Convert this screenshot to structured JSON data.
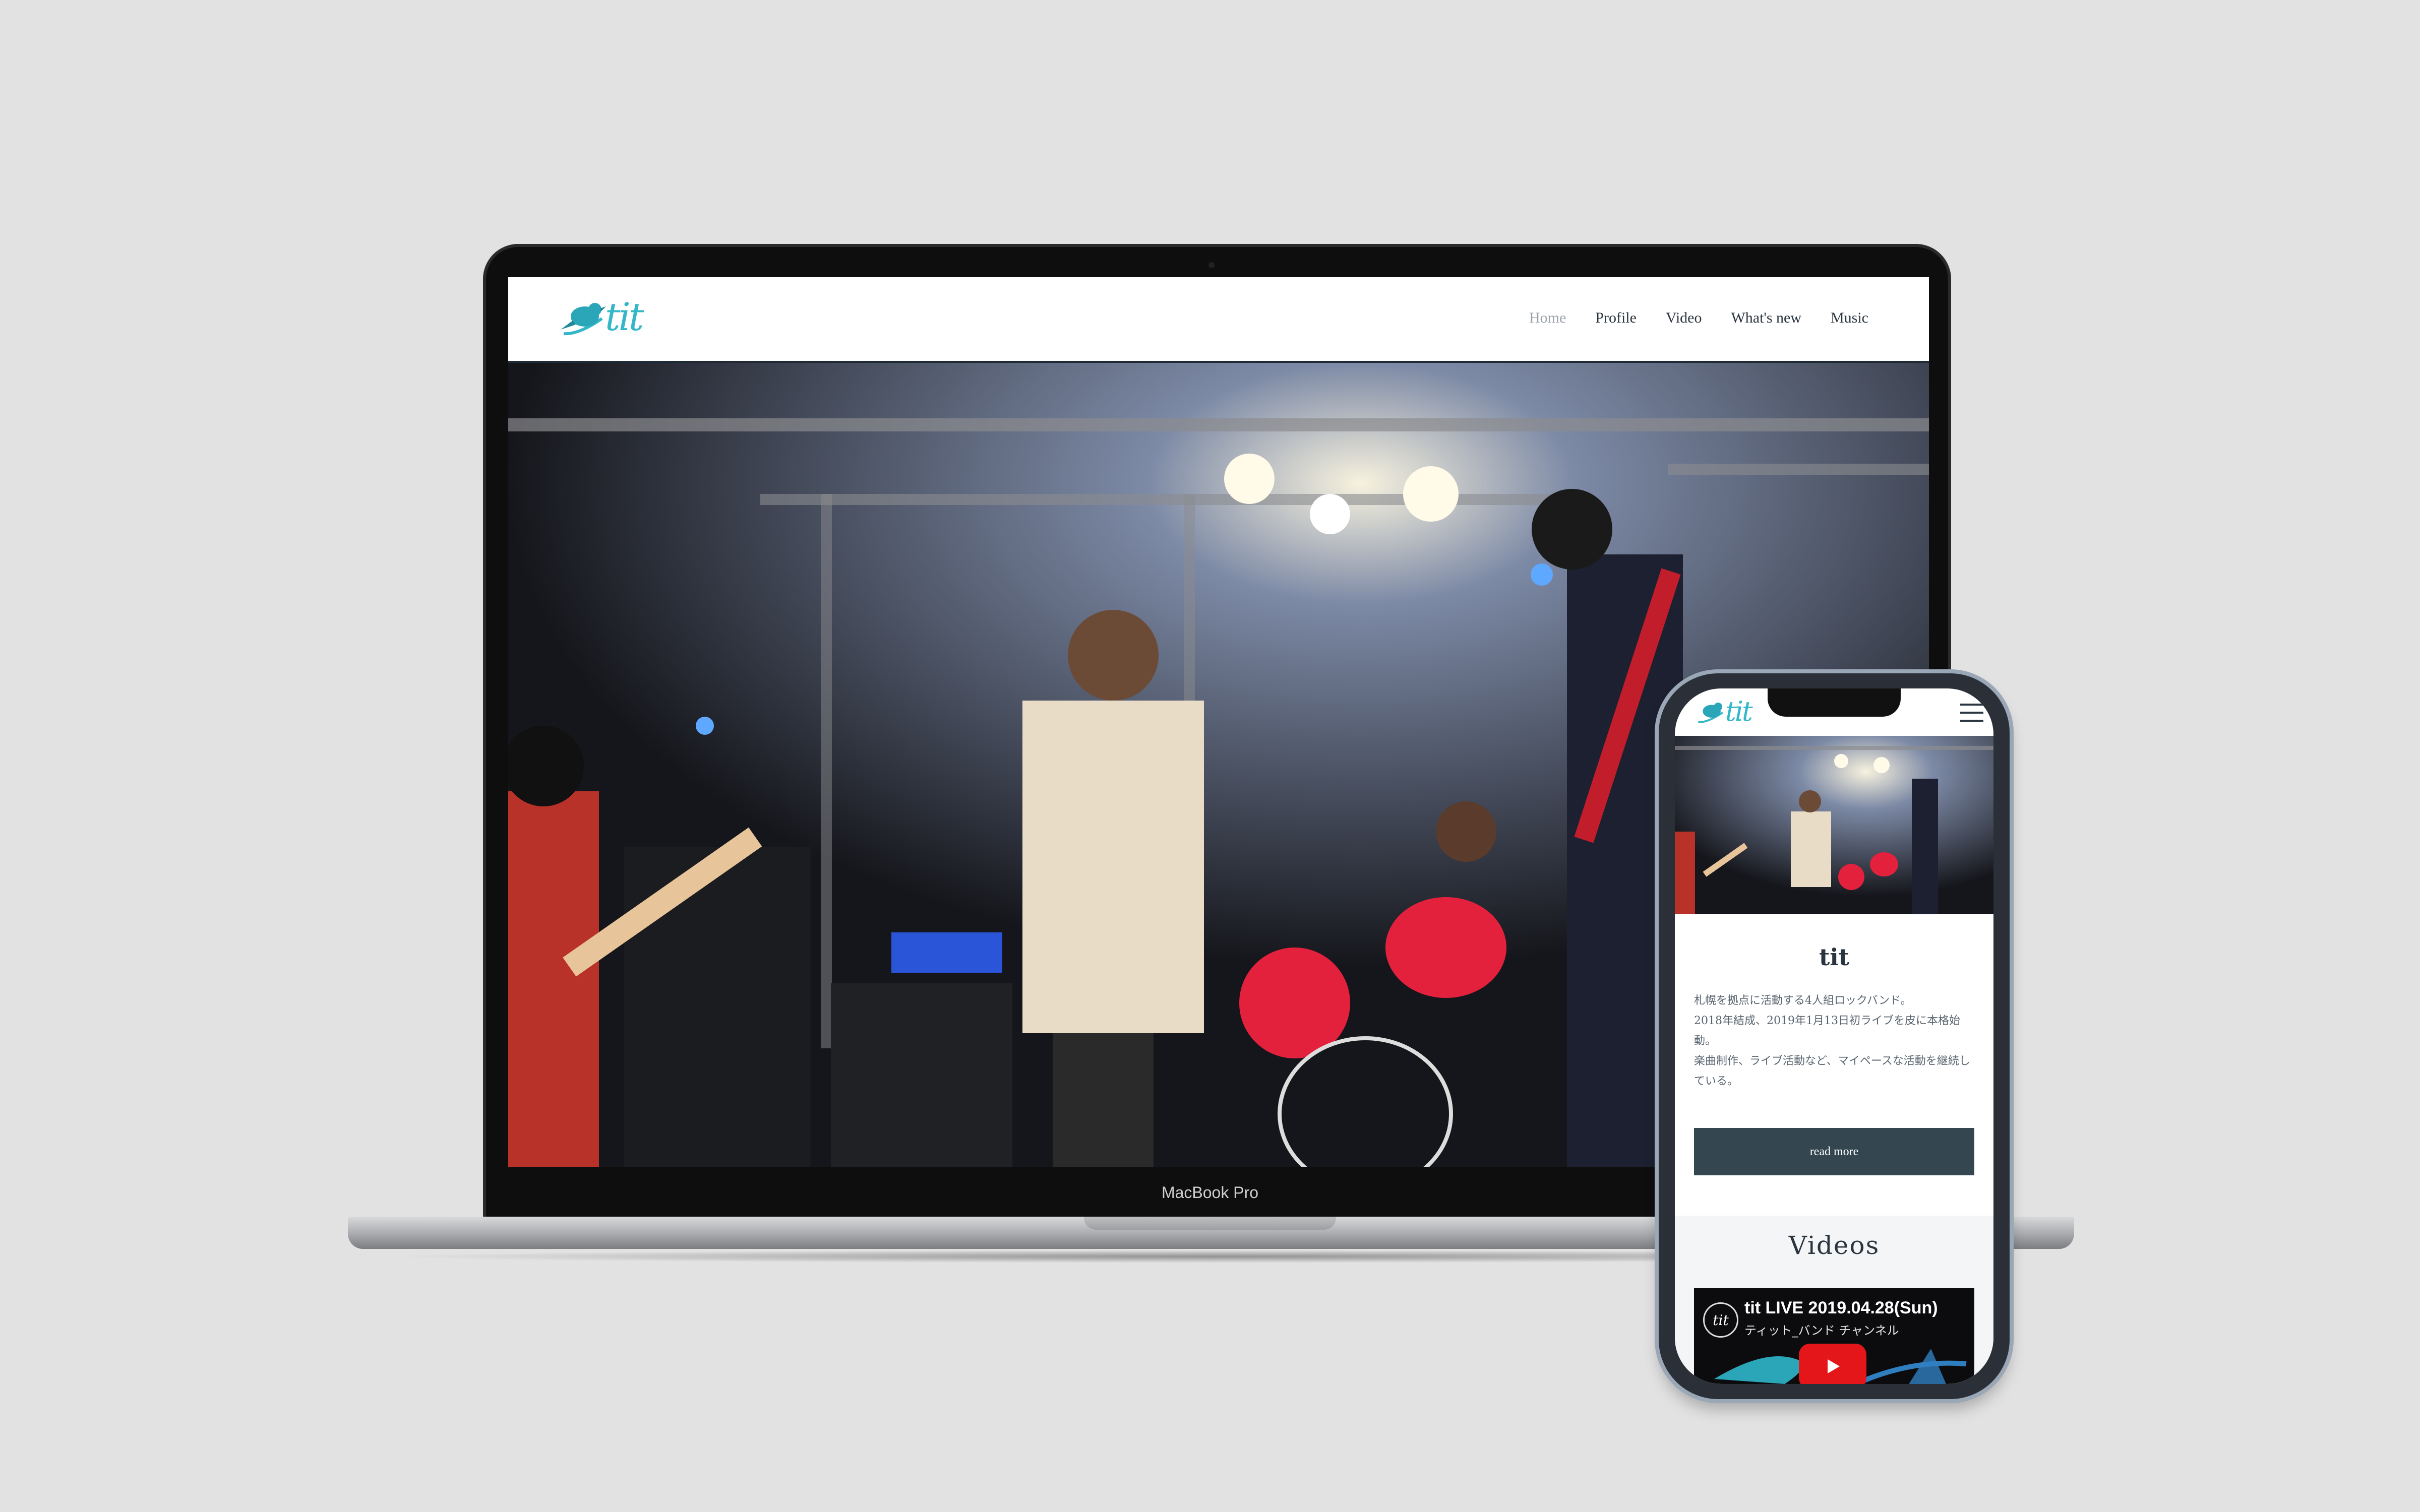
{
  "laptop": {
    "label": "MacBook Pro",
    "site": {
      "logo_text": "tit",
      "nav": [
        {
          "label": "Home",
          "active": true
        },
        {
          "label": "Profile"
        },
        {
          "label": "Video"
        },
        {
          "label": "What's new"
        },
        {
          "label": "Music"
        }
      ],
      "hero_image": "live-band-stage-photo"
    }
  },
  "phone": {
    "logo_text": "tit",
    "menu_icon": "hamburger-menu-icon",
    "hero_image": "live-band-stage-photo",
    "band_name": "tit",
    "description": [
      "札幌を拠点に活動する4人組ロックバンド。",
      "2018年結成、2019年1月13日初ライブを皮に本格始動。",
      "楽曲制作、ライブ活動など、マイペースな活動を継続している。"
    ],
    "read_more": "read more",
    "videos": {
      "title": "Videos",
      "video_title": "tit LIVE 2019.04.28(Sun)",
      "channel": "ティット_バンド チャンネル",
      "avatar_text": "tit"
    }
  },
  "colors": {
    "accent": "#34b7c8",
    "navy": "#2b3540",
    "button": "#34464f",
    "youtube": "#e4161a"
  }
}
